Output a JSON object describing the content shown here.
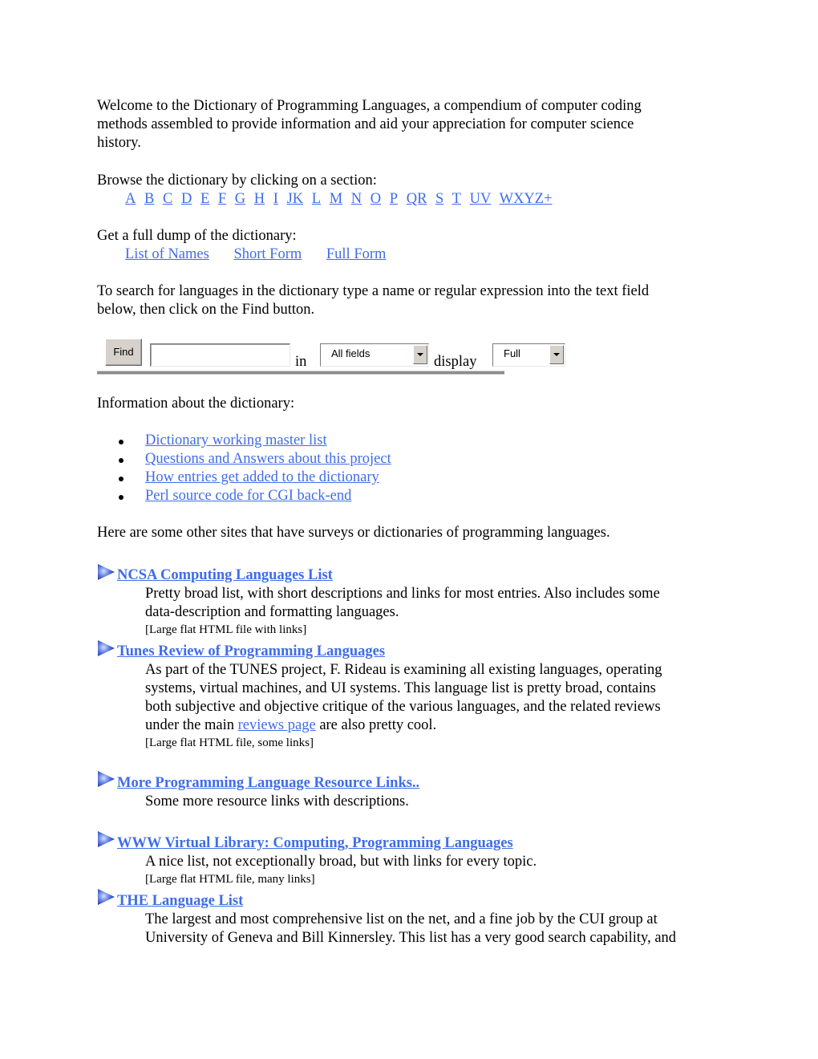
{
  "intro": {
    "line1": "Welcome to the Dictionary of Programming Languages, a compendium of computer coding",
    "line2": "methods assembled to provide information and aid your appreciation for computer science",
    "line3": "history."
  },
  "browse": {
    "label": "Browse the dictionary by clicking on a section:",
    "sections": [
      "A",
      "B",
      "C",
      "D",
      "E",
      "F",
      "G",
      "H",
      "I",
      "JK",
      "L",
      "M",
      "N",
      "O",
      "P",
      "QR",
      "S",
      "T",
      "UV",
      "WXYZ+"
    ]
  },
  "dump": {
    "label": "Get a full dump of the dictionary:",
    "links": [
      "List of Names",
      "Short Form",
      "Full Form"
    ]
  },
  "search": {
    "instructions_line1": "To search for languages in the dictionary type a name or regular expression into the text field",
    "instructions_line2": "below, then click on the Find button.",
    "find_button": "Find",
    "query_value": "",
    "in_label": "in",
    "field_select": "All fields",
    "display_label": "display",
    "display_select": "Full"
  },
  "info": {
    "label": "Information about the dictionary:",
    "links": [
      "Dictionary working master list",
      "Questions and Answers about this project",
      "How entries get added to the dictionary",
      "Perl source code for CGI back-end"
    ]
  },
  "other_sites": {
    "label": "Here are some other sites that have surveys or dictionaries of programming languages.",
    "sites": [
      {
        "title": "NCSA Computing Languages List ",
        "desc_lines": [
          "Pretty broad list, with short descriptions and links for most entries. Also includes some",
          "data-description and formatting languages."
        ],
        "note": "[Large flat HTML file with links]"
      },
      {
        "title": "Tunes Review of Programming Languages ",
        "desc_lines": [
          "As part of the TUNES project, F. Rideau is examining all existing languages, operating",
          "systems, virtual machines, and UI systems. This language list is pretty broad, contains",
          "both subjective and objective critique of the various languages, and the related reviews"
        ],
        "desc_last_pre": "under the main ",
        "desc_last_link": "reviews page",
        "desc_last_post": " are also pretty cool.",
        "note": "[Large flat HTML file, some links]"
      },
      {
        "title": "More Programming Language Resource Links.. ",
        "desc_lines": [
          "Some more resource links with descriptions."
        ]
      },
      {
        "title": "WWW Virtual Library: Computing, Programming Languages ",
        "desc_lines": [
          "A nice list, not exceptionally broad, but with links for every topic."
        ],
        "note": "[Large flat HTML file, many links]"
      },
      {
        "title": "THE Language List ",
        "desc_lines": [
          "The largest and most comprehensive list on the net, and a fine job by the CUI group at",
          "University of Geneva and Bill Kinnersley. This list has a very good search capability, and"
        ]
      }
    ]
  },
  "colors": {
    "link": "#3f6de8",
    "text": "#000000"
  }
}
